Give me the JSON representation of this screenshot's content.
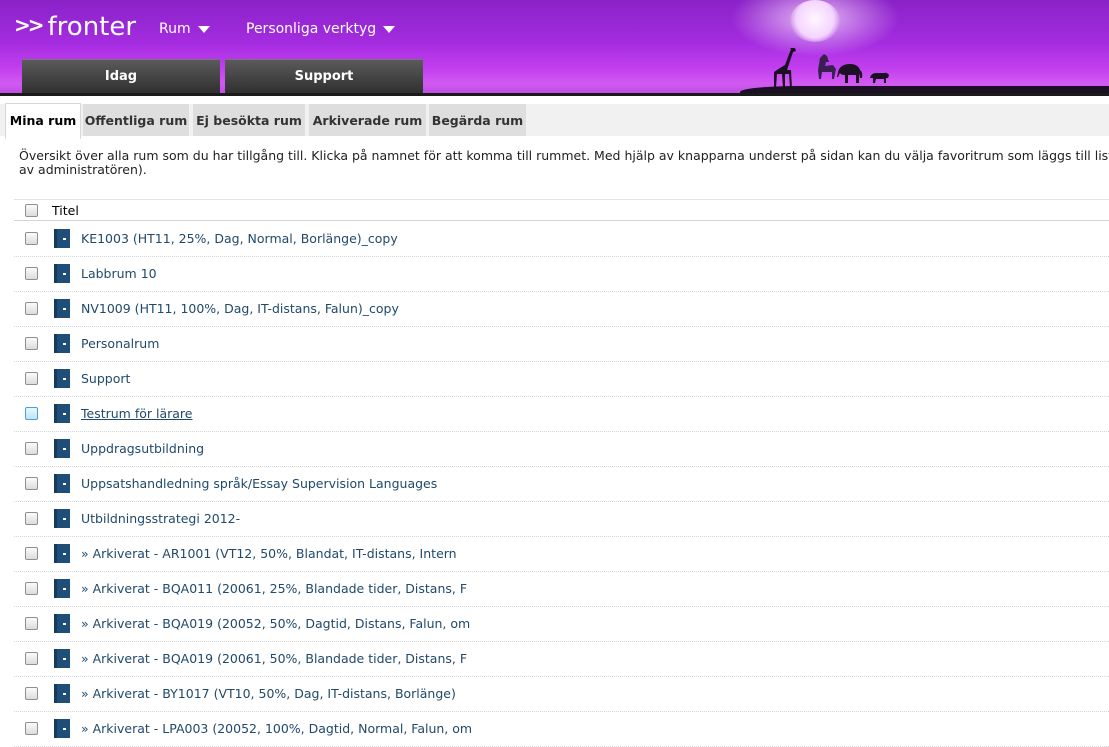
{
  "header": {
    "logo_arrows": ">>",
    "logo_text": "fronter",
    "nav": [
      {
        "label": "Rum"
      },
      {
        "label": "Personliga verktyg"
      }
    ],
    "big_tabs": [
      {
        "label": "Idag"
      },
      {
        "label": "Support"
      }
    ]
  },
  "room_tabs": [
    {
      "label": "Mina rum",
      "active": true
    },
    {
      "label": "Offentliga rum",
      "active": false
    },
    {
      "label": "Ej besökta rum",
      "active": false
    },
    {
      "label": "Arkiverade rum",
      "active": false
    },
    {
      "label": "Begärda rum",
      "active": false
    }
  ],
  "intro": {
    "line1": "Översikt över alla rum som du har tillgång till. Klicka på namnet för att komma till rummet. Med hjälp av knapparna underst på sidan kan du välja favoritrum som läggs till lista",
    "line2": "av administratören)."
  },
  "table": {
    "header_title": "Titel",
    "rows": [
      {
        "title": "KE1003 (HT11, 25%, Dag, Normal, Borlänge)_copy",
        "hover": false
      },
      {
        "title": "Labbrum 10",
        "hover": false
      },
      {
        "title": "NV1009 (HT11, 100%, Dag, IT-distans, Falun)_copy",
        "hover": false
      },
      {
        "title": "Personalrum",
        "hover": false
      },
      {
        "title": "Support",
        "hover": false
      },
      {
        "title": "Testrum för lärare",
        "hover": true
      },
      {
        "title": "Uppdragsutbildning",
        "hover": false
      },
      {
        "title": "Uppsatshandledning språk/Essay Supervision Languages",
        "hover": false
      },
      {
        "title": "Utbildningsstrategi 2012-",
        "hover": false
      },
      {
        "title": "» Arkiverat - AR1001 (VT12, 50%, Blandat, IT-distans, Intern",
        "hover": false
      },
      {
        "title": "» Arkiverat - BQA011 (20061, 25%, Blandade tider, Distans, F",
        "hover": false
      },
      {
        "title": "» Arkiverat - BQA019 (20052, 50%, Dagtid, Distans, Falun, om",
        "hover": false
      },
      {
        "title": "» Arkiverat - BQA019 (20061, 50%, Blandade tider, Distans, F",
        "hover": false
      },
      {
        "title": "» Arkiverat - BY1017 (VT10, 50%, Dag, IT-distans, Borlänge)",
        "hover": false
      },
      {
        "title": "» Arkiverat - LPA003 (20052, 100%, Dagtid, Normal, Falun, om",
        "hover": false
      }
    ]
  },
  "colors": {
    "header_purple": "#a42ce0",
    "link": "#21496b",
    "room_icon": "#1f4e79"
  }
}
